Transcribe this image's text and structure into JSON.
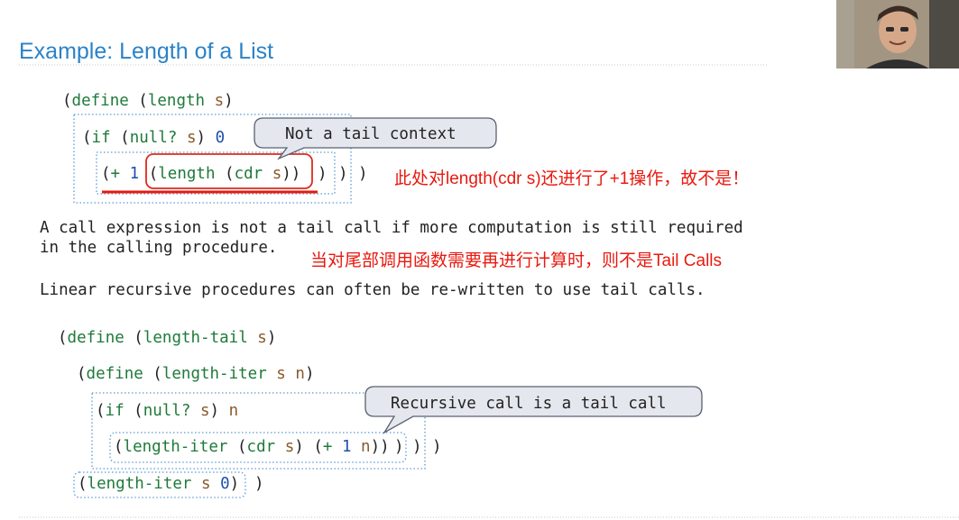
{
  "slide": {
    "title": "Example: Length of a List"
  },
  "code1": {
    "l1_open": "(",
    "l1_define": "define",
    "l1_open2": " (",
    "l1_length": "length",
    "l1_sp": " ",
    "l1_s": "s",
    "l1_close": ")",
    "l2_open": "(",
    "l2_if": "if",
    "l2_open2": " (",
    "l2_null": "null?",
    "l2_sp": " ",
    "l2_s": "s",
    "l2_close": ")",
    "l2_zero": " 0",
    "l3_open": "(",
    "l3_plus": "+",
    "l3_sp": " ",
    "l3_one": "1",
    "l3_open2": " (",
    "l3_length": "length",
    "l3_open3": " (",
    "l3_cdr": "cdr",
    "l3_sp2": " ",
    "l3_s": "s",
    "l3_close2": "))",
    "l3_close_a": ")",
    "l3_close_b": ")",
    "l3_close_c": ")"
  },
  "callout1": {
    "text": "Not a tail context"
  },
  "annotation1": {
    "text": "此处对length(cdr s)还进行了+1操作，故不是！"
  },
  "para1": {
    "line1": "A call expression is not a tail call if more computation is still required",
    "line2": "in the calling procedure."
  },
  "annotation2": {
    "text": "当对尾部调用函数需要再进行计算时，则不是Tail Calls"
  },
  "para2": {
    "line1": "Linear recursive procedures can often be re-written to use tail calls."
  },
  "code2": {
    "l1_open": "(",
    "l1_define": "define",
    "l1_open2": " (",
    "l1_name": "length-tail",
    "l1_sp": " ",
    "l1_s": "s",
    "l1_close": ")",
    "l2_open": "(",
    "l2_define": "define",
    "l2_open2": " (",
    "l2_name": "length-iter",
    "l2_sp": " ",
    "l2_s": "s",
    "l2_sp2": " ",
    "l2_n": "n",
    "l2_close": ")",
    "l3_open": "(",
    "l3_if": "if",
    "l3_open2": " (",
    "l3_null": "null?",
    "l3_sp": " ",
    "l3_s": "s",
    "l3_close": ")",
    "l3_sp2": " ",
    "l3_n": "n",
    "l4_open": "(",
    "l4_name": "length-iter",
    "l4_open2": " (",
    "l4_cdr": "cdr",
    "l4_sp": " ",
    "l4_s": "s",
    "l4_close": ")",
    "l4_open3": " (",
    "l4_plus": "+",
    "l4_sp2": " ",
    "l4_one": "1",
    "l4_sp3": " ",
    "l4_n": "n",
    "l4_close2": "))",
    "l4_close_a": ")",
    "l4_close_b": ")",
    "l4_close_c": ")",
    "l5_open": "(",
    "l5_name": "length-iter",
    "l5_sp": " ",
    "l5_s": "s",
    "l5_sp2": " ",
    "l5_zero": "0",
    "l5_close": ")",
    "l5_close_a": ")"
  },
  "callout2": {
    "text": "Recursive call is a tail call"
  },
  "colors": {
    "title": "#2a82c8",
    "keyword": "#1f7a3a",
    "variable": "#8a5a2b",
    "number": "#1f4fb0",
    "annotation": "#e8190f",
    "box": "#5b9bd5"
  },
  "presenter": {
    "icon": "presenter-webcam-icon"
  }
}
